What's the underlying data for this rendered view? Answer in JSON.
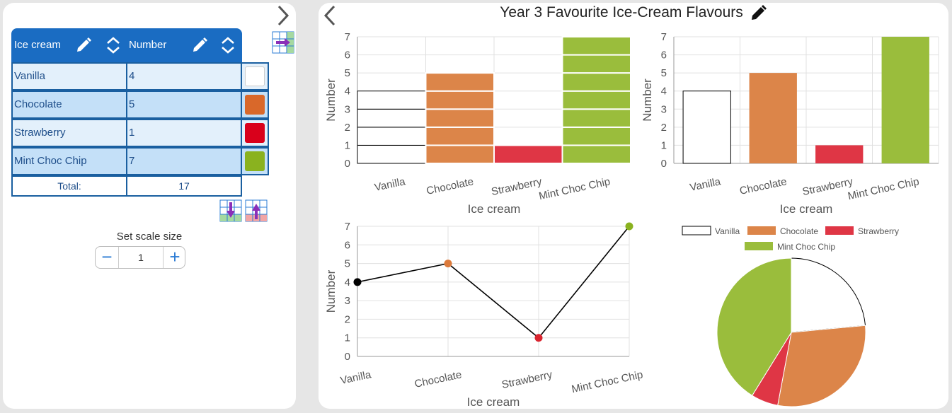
{
  "table": {
    "col1_header": "Ice cream",
    "col2_header": "Number",
    "rows": [
      {
        "label": "Vanilla",
        "value": "4",
        "color": "#ffffff"
      },
      {
        "label": "Chocolate",
        "value": "5",
        "color": "#d9682a"
      },
      {
        "label": "Strawberry",
        "value": "1",
        "color": "#d9001b"
      },
      {
        "label": "Mint  Choc Chip",
        "value": "7",
        "color": "#8ab21f"
      }
    ],
    "total_label": "Total:",
    "total_value": "17"
  },
  "scale": {
    "label": "Set scale size",
    "value": "1",
    "minus": "−",
    "plus": "+"
  },
  "title": "Year 3 Favourite Ice-Cream Flavours",
  "icons": [
    "chevron-right-icon",
    "chevron-left-icon",
    "pencil-icon",
    "sort-arrows-icon",
    "add-column-icon",
    "add-row-icon",
    "remove-row-icon"
  ],
  "chart_data": [
    {
      "type": "bar",
      "style": "pictogram-blocks",
      "categories": [
        "Vanilla",
        "Chocolate",
        "Strawberry",
        "Mint  Choc Chip"
      ],
      "values": [
        4,
        5,
        1,
        7
      ],
      "colors": [
        "#ffffff",
        "#dc8549",
        "#df3645",
        "#9abd3c"
      ],
      "xlabel": "Ice cream",
      "ylabel": "Number",
      "ylim": [
        0,
        7
      ],
      "yticks": [
        "0",
        "1",
        "2",
        "3",
        "4",
        "5",
        "6",
        "7"
      ]
    },
    {
      "type": "bar",
      "categories": [
        "Vanilla",
        "Chocolate",
        "Strawberry",
        "Mint  Choc Chip"
      ],
      "values": [
        4,
        5,
        1,
        7
      ],
      "colors": [
        "#ffffff",
        "#dc8549",
        "#df3645",
        "#9abd3c"
      ],
      "xlabel": "Ice cream",
      "ylabel": "Number",
      "ylim": [
        0,
        7
      ],
      "yticks": [
        "0",
        "1",
        "2",
        "3",
        "4",
        "5",
        "6",
        "7"
      ]
    },
    {
      "type": "line",
      "categories": [
        "Vanilla",
        "Chocolate",
        "Strawberry",
        "Mint  Choc Chip"
      ],
      "values": [
        4,
        5,
        1,
        7
      ],
      "colors": [
        "#000000",
        "#dc7a3b",
        "#d9242f",
        "#8ab21f"
      ],
      "xlabel": "Ice cream",
      "ylabel": "Number",
      "ylim": [
        0,
        7
      ],
      "yticks": [
        "0",
        "1",
        "2",
        "3",
        "4",
        "5",
        "6",
        "7"
      ]
    },
    {
      "type": "pie",
      "categories": [
        "Vanilla",
        "Chocolate",
        "Strawberry",
        "Mint  Choc Chip"
      ],
      "values": [
        4,
        5,
        1,
        7
      ],
      "colors": [
        "#ffffff",
        "#dc8549",
        "#df3645",
        "#9abd3c"
      ],
      "legend": "top"
    }
  ]
}
